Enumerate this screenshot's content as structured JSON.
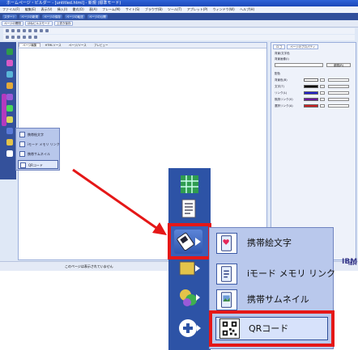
{
  "window": {
    "title": "ホームページ・ビルダー - [untitled.html] - 新規 (標準モード)"
  },
  "menu": [
    "ファイル(F)",
    "編集(E)",
    "表示(V)",
    "挿入(I)",
    "書式(O)",
    "表(A)",
    "フレーム(M)",
    "サイト(S)",
    "ブラウザ(B)",
    "ツール(T)",
    "アプレット(P)",
    "ウィンドウ(W)",
    "ヘルプ(H)"
  ],
  "toolbar_top": [
    "スタート",
    "ページの新規",
    "ページの保存",
    "ページの転送",
    "ページの公開"
  ],
  "toolbar_second": [
    "ページの開閉",
    "ほねビルスモード",
    "上書き保存"
  ],
  "editor_tabs": [
    "ページ編集",
    "HTMLソース",
    "ページ/ソース",
    "プレビュー"
  ],
  "right_panel": {
    "tabs": [
      "ロゴ",
      "ページのプロパティ"
    ],
    "section_background": "背景/文字色",
    "background_image_label": "背景画像(I)",
    "reference_button": "参照(R)",
    "section_color": "配色",
    "color_rows": [
      {
        "label": "背景色(B)",
        "color": "#ffffff"
      },
      {
        "label": "文字(T)",
        "color": "#000000"
      },
      {
        "label": "リンク(L)",
        "color": "#2222cc"
      },
      {
        "label": "既読リンク(V)",
        "color": "#6a1a9a"
      },
      {
        "label": "選択リンク(A)",
        "color": "#cc2222"
      }
    ]
  },
  "status_bar": {
    "text": "このページは表示されていません"
  },
  "ibm_logo": "IBM",
  "small_menu": [
    {
      "label": "携帯絵文字",
      "icon": "emoji-icon"
    },
    {
      "label": "iモード メモリ リンク",
      "icon": "imode-link-icon"
    },
    {
      "label": "携帯サムネイル",
      "icon": "thumbnail-icon"
    },
    {
      "label": "QRコード",
      "icon": "qr-code-icon"
    }
  ],
  "big_menu": [
    {
      "label": "携帯絵文字",
      "icon": "emoji-icon"
    },
    {
      "label": "iモード メモリ リンク",
      "icon": "imode-link-icon"
    },
    {
      "label": "携帯サムネイル",
      "icon": "thumbnail-icon"
    },
    {
      "label": "QRコード",
      "icon": "qr-code-icon"
    }
  ],
  "colors": {
    "highlight": "#e51717",
    "panel_blue": "#2d53a6",
    "menu_bg": "#b9c8ec"
  }
}
